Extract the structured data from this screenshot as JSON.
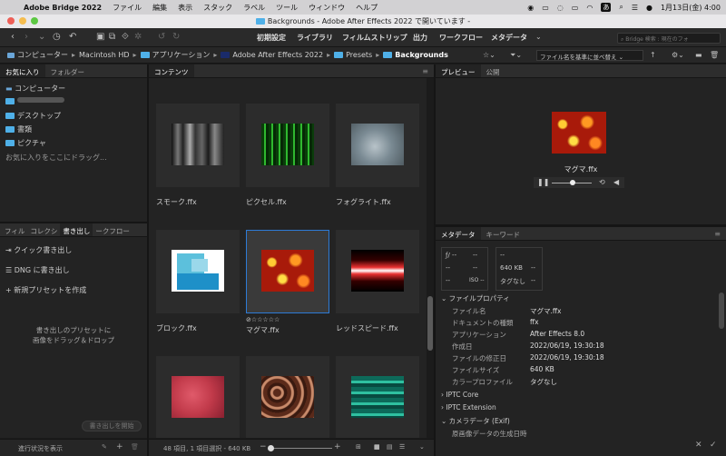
{
  "menubar": {
    "app": "Adobe Bridge 2022",
    "items": [
      "ファイル",
      "編集",
      "表示",
      "スタック",
      "ラベル",
      "ツール",
      "ウィンドウ",
      "ヘルプ"
    ],
    "ime": "あ",
    "clock": "1月13日(金)  4:00"
  },
  "window": {
    "title": "Backgrounds - Adobe After Effects 2022 で開いています -"
  },
  "toolbar": {
    "workspaces": [
      "初期設定",
      "ライブラリ",
      "フィルムストリップ",
      "出力",
      "ワークフロー",
      "メタデータ"
    ],
    "search_placeholder": "Bridge 検索 : 現在のフォ"
  },
  "path": {
    "items": [
      "コンピューター",
      "Macintosh HD",
      "アプリケーション",
      "Adobe After Effects 2022",
      "Presets"
    ],
    "current": "Backgrounds",
    "sort_label": "ファイル名を基準に並べ替え"
  },
  "favorites": {
    "tabs": [
      "お気に入り",
      "フォルダー"
    ],
    "computer": "コンピューター",
    "items": [
      "デスクトップ",
      "書類",
      "ピクチャ"
    ],
    "hint": "お気に入りをここにドラッグ..."
  },
  "export": {
    "tabs": [
      "フィル",
      "コレクシ",
      "書き出し",
      "ークフロー"
    ],
    "quick": "クイック書き出し",
    "dng": "DNG に書き出し",
    "new_preset": "新規プリセットを作成",
    "drop_hint_1": "書き出しのプリセットに",
    "drop_hint_2": "画像をドラッグ＆ドロップ",
    "start_button": "書き出しを開始",
    "progress_link": "進行状況を表示"
  },
  "content": {
    "tab": "コンテンツ",
    "items": [
      {
        "name": "スモーク.ffx"
      },
      {
        "name": "ピクセル.ffx"
      },
      {
        "name": "フォグライト.ffx"
      },
      {
        "name": "ブロック.ffx"
      },
      {
        "name": "マグマ.ffx",
        "rating": "⊘☆☆☆☆☆"
      },
      {
        "name": "レッドスピード.ffx"
      },
      {
        "name": ""
      },
      {
        "name": ""
      },
      {
        "name": ""
      }
    ],
    "status": "48 項目, 1 項目選択 - 640 KB"
  },
  "preview": {
    "tabs": [
      "プレビュー",
      "公開"
    ],
    "filename": "マグマ.ffx"
  },
  "metadata": {
    "tabs": [
      "メタデータ",
      "キーワード"
    ],
    "box1": {
      "f": "ƒ/ --",
      "a": "--",
      "b": "--",
      "c": "--",
      "iso": "ISO --",
      "d": "--"
    },
    "box2": {
      "a": "--",
      "size": "640 KB",
      "b": "--",
      "tag": "タグなし",
      "c": "--"
    },
    "section_file": "ファイルプロパティ",
    "rows": [
      {
        "k": "ファイル名",
        "v": "マグマ.ffx"
      },
      {
        "k": "ドキュメントの種類",
        "v": "ffx"
      },
      {
        "k": "アプリケーション",
        "v": "After Effects 8.0"
      },
      {
        "k": "作成日",
        "v": "2022/06/19, 19:30:18"
      },
      {
        "k": "ファイルの修正日",
        "v": "2022/06/19, 19:30:18"
      },
      {
        "k": "ファイルサイズ",
        "v": "640 KB"
      },
      {
        "k": "カラープロファイル",
        "v": "タグなし"
      }
    ],
    "sections": [
      "IPTC Core",
      "IPTC Extension",
      "カメラデータ (Exif)"
    ],
    "last_row": "原画像データの生成日時"
  }
}
